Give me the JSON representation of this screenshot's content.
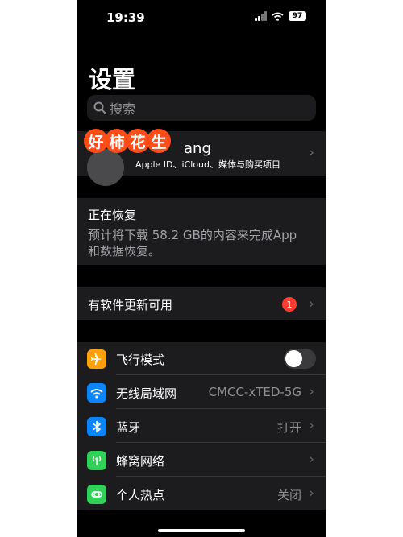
{
  "status": {
    "time": "19:39",
    "battery": "97"
  },
  "header": {
    "title": "设置"
  },
  "search": {
    "placeholder": "搜索"
  },
  "sticker": {
    "chars": [
      "好",
      "柿",
      "花",
      "生"
    ]
  },
  "profile": {
    "name_visible": "ang",
    "subtitle": "Apple ID、iCloud、媒体与购买项目"
  },
  "restore": {
    "title": "正在恢复",
    "body": "预计将下载 58.2 GB的内容来完成App和数据恢复。"
  },
  "update": {
    "label": "有软件更新可用",
    "badge": "1"
  },
  "settings": {
    "airplane": {
      "label": "飞行模式",
      "icon": "airplane-icon",
      "color": "#ff9f0a",
      "enabled": false
    },
    "wifi": {
      "label": "无线局域网",
      "value": "CMCC-xTED-5G",
      "icon": "wifi-icon",
      "color": "#0a84ff"
    },
    "bluetooth": {
      "label": "蓝牙",
      "value": "打开",
      "icon": "bluetooth-icon",
      "color": "#0a84ff"
    },
    "cellular": {
      "label": "蜂窝网络",
      "icon": "antenna-icon",
      "color": "#30d158"
    },
    "hotspot": {
      "label": "个人热点",
      "value": "关闭",
      "icon": "hotspot-icon",
      "color": "#30d158"
    }
  }
}
